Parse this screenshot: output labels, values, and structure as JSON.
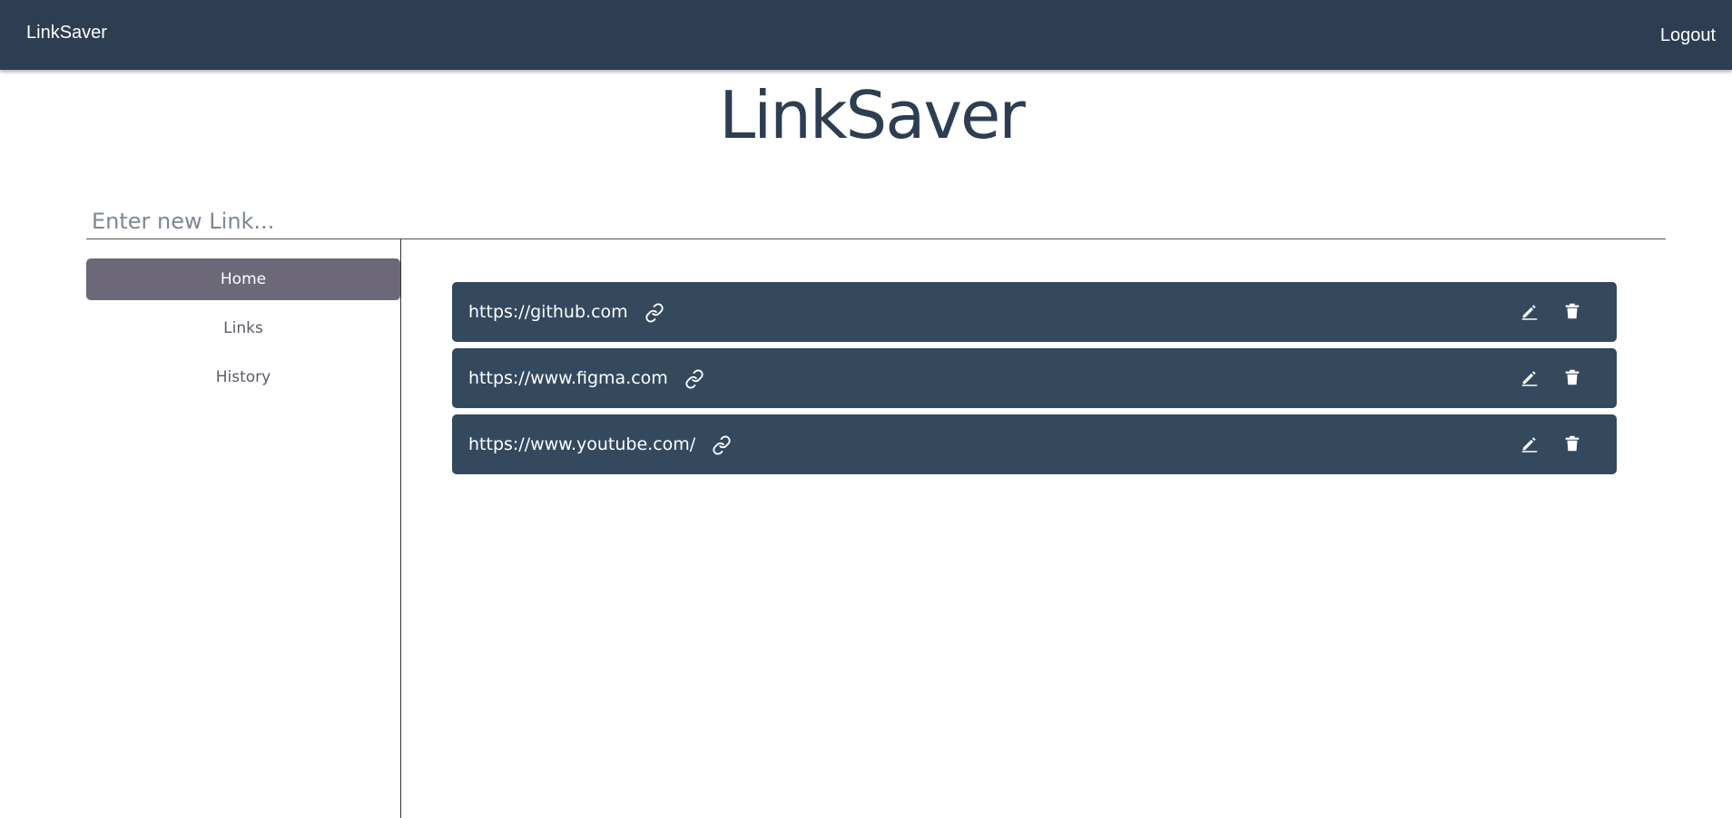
{
  "navbar": {
    "brand": "LinkSaver",
    "logout_label": "Logout",
    "background_color": "#2e3e52"
  },
  "page": {
    "title": "LinkSaver"
  },
  "new_link": {
    "placeholder": "Enter new Link...",
    "value": ""
  },
  "sidebar": {
    "items": [
      {
        "label": "Home",
        "active": true
      },
      {
        "label": "Links",
        "active": false
      },
      {
        "label": "History",
        "active": false
      }
    ],
    "active_color": "#6c6878"
  },
  "links": {
    "card_color": "#34495e",
    "items": [
      {
        "url": "https://github.com",
        "link_icon": "chain-link-icon",
        "edit_icon": "pencil-icon",
        "delete_icon": "trash-icon"
      },
      {
        "url": "https://www.figma.com",
        "link_icon": "chain-link-icon",
        "edit_icon": "pencil-icon",
        "delete_icon": "trash-icon"
      },
      {
        "url": "https://www.youtube.com/",
        "link_icon": "chain-link-icon",
        "edit_icon": "pencil-icon",
        "delete_icon": "trash-icon"
      }
    ]
  }
}
